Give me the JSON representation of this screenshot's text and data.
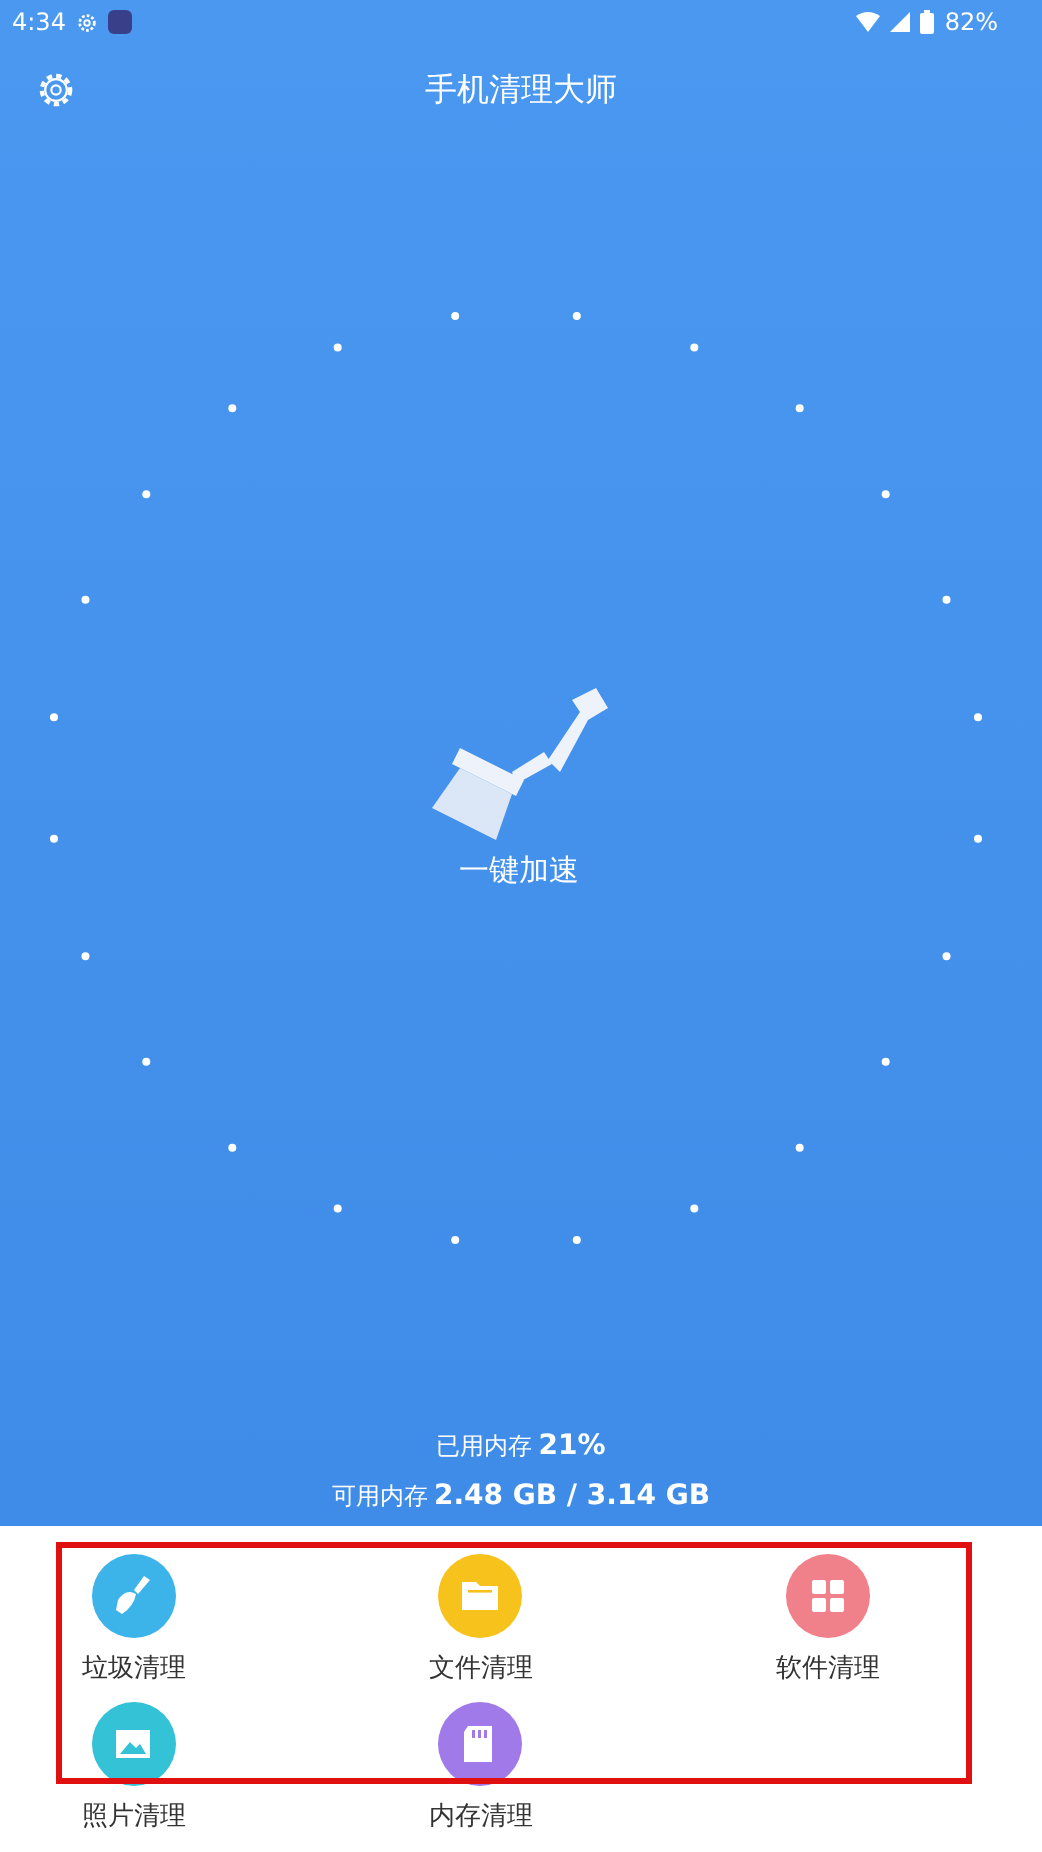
{
  "status_bar": {
    "time": "4:34",
    "battery": "82%"
  },
  "header": {
    "title": "手机清理大师"
  },
  "boost": {
    "label": "一键加速"
  },
  "memory": {
    "used_label": "已用内存",
    "used_value": "21%",
    "free_label": "可用内存",
    "free_value": "2.48 GB / 3.14 GB"
  },
  "tools": [
    {
      "label": "垃圾清理",
      "kind": "broom",
      "color": "#3cb4ea"
    },
    {
      "label": "文件清理",
      "kind": "folder",
      "color": "#f7c21c"
    },
    {
      "label": "软件清理",
      "kind": "apps",
      "color": "#f0808a"
    },
    {
      "label": "照片清理",
      "kind": "photo",
      "color": "#33c2d6"
    },
    {
      "label": "内存清理",
      "kind": "card",
      "color": "#a07ae8"
    }
  ]
}
